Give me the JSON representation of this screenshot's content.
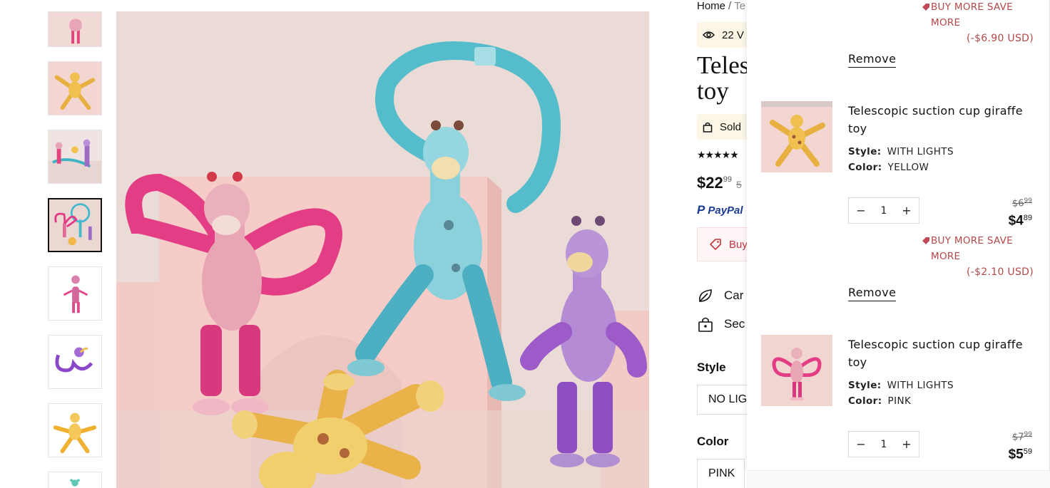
{
  "gallery": {
    "thumbnails": [
      {
        "name": "thumb-pink-giraffe-top"
      },
      {
        "name": "thumb-yellow-giraffe"
      },
      {
        "name": "thumb-group-giraffes"
      },
      {
        "name": "thumb-all-giraffes"
      },
      {
        "name": "thumb-pink-standing"
      },
      {
        "name": "thumb-purple-giraffe"
      },
      {
        "name": "thumb-yellow-star"
      },
      {
        "name": "thumb-teal-giraffe"
      }
    ],
    "active_index": 3
  },
  "product": {
    "breadcrumb_home": "Home",
    "breadcrumb_sep": "/",
    "breadcrumb_current": "Te",
    "views_text": "22 V",
    "title_line1": "Teles",
    "title_line2": "toy",
    "sold_text": "Sold",
    "stars": "★★★★★",
    "price_main": "$22",
    "price_cents": "99",
    "price_old": "5",
    "paypal_label": "PayPal",
    "buy_more_text": "Buy",
    "feature_1": "Car",
    "feature_2": "Sec",
    "style_label": "Style",
    "style_value": "NO LIG",
    "color_label": "Color",
    "color_value": "PINK"
  },
  "cart": {
    "top_partial": {
      "save_note": "BUY MORE SAVE MORE",
      "save_amount": "(-$6.90 USD)",
      "remove_label": "Remove"
    },
    "items": [
      {
        "name": "Telescopic suction cup giraffe toy",
        "style_label": "Style:",
        "style_value": "WITH LIGHTS",
        "color_label": "Color:",
        "color_value": "YELLOW",
        "quantity": "1",
        "old_price": "$6",
        "old_cents": "99",
        "price": "$4",
        "price_cents": "89",
        "save_note": "BUY MORE SAVE MORE",
        "save_amount": "(-$2.10 USD)",
        "remove_label": "Remove"
      },
      {
        "name": "Telescopic suction cup giraffe toy",
        "style_label": "Style:",
        "style_value": "WITH LIGHTS",
        "color_label": "Color:",
        "color_value": "PINK",
        "quantity": "1",
        "old_price": "$7",
        "old_cents": "99",
        "price": "$5",
        "price_cents": "59"
      }
    ]
  },
  "colors": {
    "accent_red": "#b54848",
    "paypal_blue": "#1a3b8f",
    "pill_bg": "#fbf6e6"
  }
}
